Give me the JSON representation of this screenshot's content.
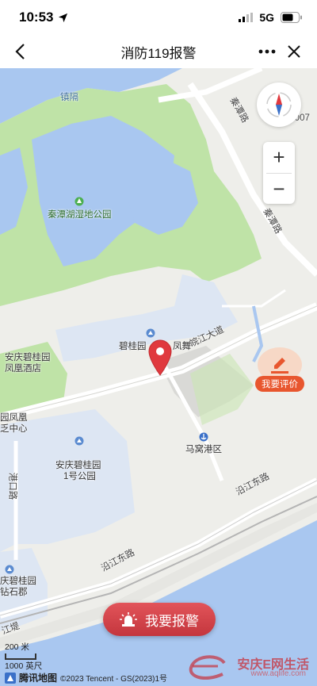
{
  "status": {
    "time": "10:53",
    "network": "5G"
  },
  "nav": {
    "title": "消防119报警"
  },
  "map": {
    "labels": {
      "zhenxu": "镇隔",
      "qintanlu_1": "秦潭路",
      "qintanlu_2": "秦潭路",
      "qintanhu_park": "秦潭湖湿地公园",
      "wanjiang": "皖江大道",
      "biguiyuan_feng": "碧桂园",
      "fengwu": "凤舞",
      "hotel_1": "安庆碧桂园",
      "hotel_2": "凤凰酒店",
      "yuanfenghuang": "园凤凰",
      "zhongxin": "乏中心",
      "mawo": "马窝港区",
      "park_1": "安庆碧桂园",
      "park_2": "1号公园",
      "gangkou": "港口路",
      "yanjiang_1": "沿江东路",
      "yanjiang_2": "沿江东路",
      "zuanshi_1": "庆碧桂园",
      "zuanshi_2": "钻石郡",
      "jiangdi": "江堤",
      "y007": "Y007"
    },
    "zoom_in": "+",
    "zoom_out": "−",
    "review_label": "我要评价",
    "alarm_label": "我要报警",
    "scale_m": "200 米",
    "scale_ft": "1000 英尺",
    "attribution_logo": "腾讯地图",
    "attribution_text": "©2023 Tencent - GS(2023)1号"
  },
  "watermark": {
    "text": "安庆E网生活",
    "url": "www.aqlife.com"
  },
  "colors": {
    "park": "#bfe3a7",
    "water": "#a9c7f0",
    "alarm": "#d1434a",
    "review": "#e8562e"
  }
}
